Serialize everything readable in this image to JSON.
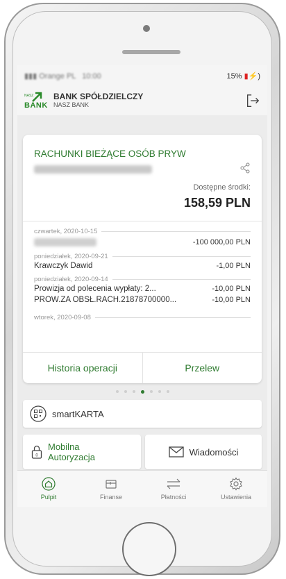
{
  "status": {
    "carrier": "Orange PL",
    "time": "10:00",
    "battery": "15%"
  },
  "header": {
    "bank_line1": "BANK SPÓŁDZIELCZY",
    "bank_line2": "NASZ BANK",
    "logo_small": "NASZ",
    "logo_big": "BANK"
  },
  "account": {
    "title": "RACHUNKI BIEŻĄCE OSÓB PRYW",
    "available_label": "Dostępne środki:",
    "available_value": "158,59 PLN"
  },
  "transactions": [
    {
      "date": "czwartek, 2020-10-15",
      "name": "",
      "amount": "-100 000,00 PLN"
    },
    {
      "date": "poniedziałek, 2020-09-21",
      "name": "Krawczyk Dawid",
      "amount": "-1,00 PLN"
    },
    {
      "date": "poniedziałek, 2020-09-14",
      "name": "Prowizja od polecenia wypłaty: 2...",
      "amount": "-10,00 PLN"
    },
    {
      "date": "",
      "name": "PROW.ZA OBSŁ.RACH.21878700000...",
      "amount": "-10,00 PLN"
    },
    {
      "date": "wtorek, 2020-09-08",
      "name": "",
      "amount": ""
    }
  ],
  "card_buttons": {
    "history": "Historia operacji",
    "transfer": "Przelew"
  },
  "pager": {
    "count": 7,
    "active": 3
  },
  "tiles": {
    "smartkarta": "smartKARTA",
    "mobile_auth_l1": "Mobilna",
    "mobile_auth_l2": "Autoryzacja",
    "messages": "Wiadomości"
  },
  "tabs": [
    {
      "label": "Pulpit",
      "icon": "home-icon"
    },
    {
      "label": "Finanse",
      "icon": "wallet-icon"
    },
    {
      "label": "Płatności",
      "icon": "transfer-arrows-icon"
    },
    {
      "label": "Ustawienia",
      "icon": "gear-icon"
    }
  ],
  "colors": {
    "accent": "#2f7b30",
    "background": "#ececec"
  }
}
